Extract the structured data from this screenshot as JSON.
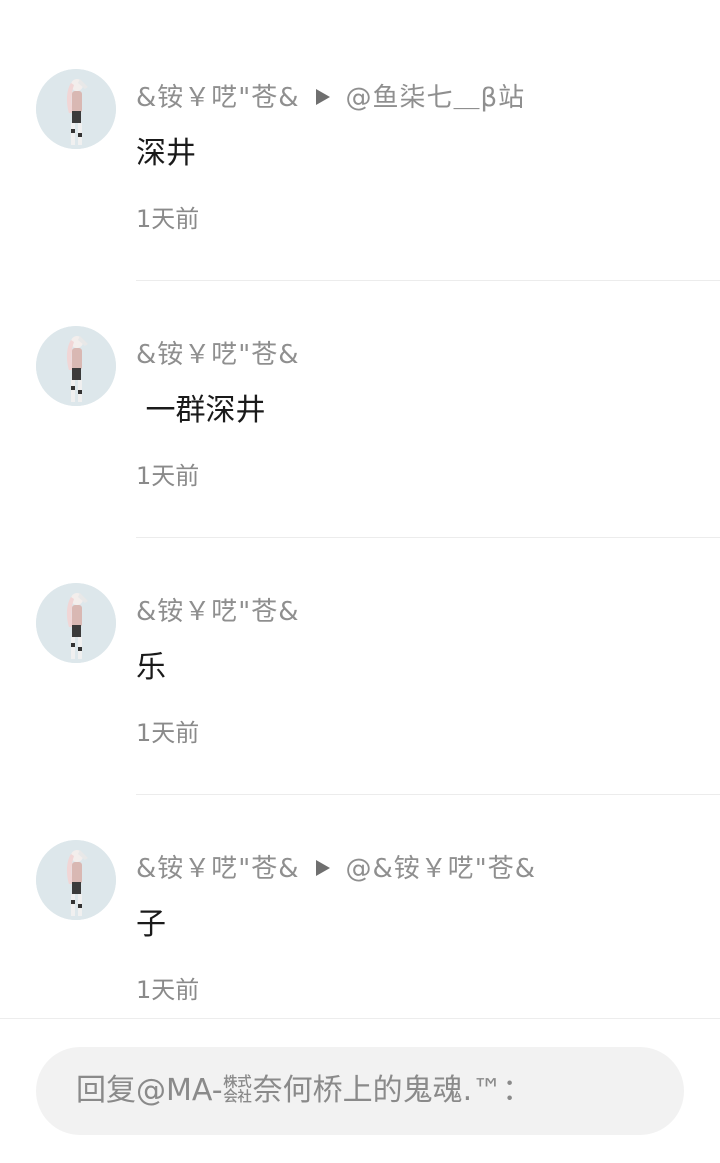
{
  "comments": [
    {
      "author": "&铵￥呓\"苍&",
      "reply_to": "@鱼柒七＿β站",
      "text": "深井",
      "time": "1天前"
    },
    {
      "author": "&铵￥呓\"苍&",
      "reply_to": "",
      "text": " 一群深井",
      "time": "1天前"
    },
    {
      "author": "&铵￥呓\"苍&",
      "reply_to": "",
      "text": "乐",
      "time": "1天前"
    },
    {
      "author": "&铵￥呓\"苍&",
      "reply_to": "@&铵￥呓\"苍&",
      "text": "子",
      "time": "1天前"
    }
  ],
  "reply_bar": {
    "placeholder": "回复@MA-㍿奈何桥上的鬼魂.™："
  },
  "colors": {
    "avatar_bg": "#dde7eb",
    "name": "#8f8f8f",
    "text": "#1a1a1a",
    "input_bg": "#f2f2f2"
  }
}
